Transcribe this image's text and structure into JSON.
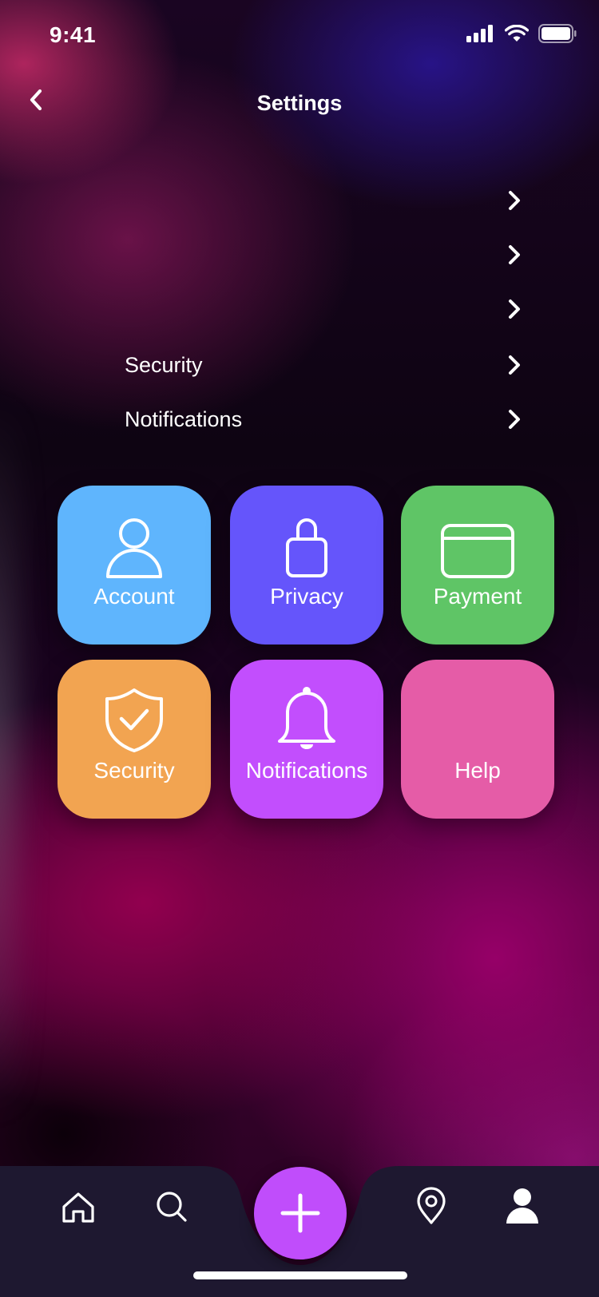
{
  "status_bar": {
    "time": "9:41"
  },
  "header": {
    "title": "Settings"
  },
  "list_items": [
    {
      "label": ""
    },
    {
      "label": ""
    },
    {
      "label": ""
    },
    {
      "label": "Security"
    },
    {
      "label": "Notifications"
    }
  ],
  "tiles": [
    {
      "label": "Account",
      "icon": "person-icon",
      "color": "#5fb5fd"
    },
    {
      "label": "Privacy",
      "icon": "lock-icon",
      "color": "#6555fb"
    },
    {
      "label": "Payment",
      "icon": "credit-card-icon",
      "color": "#5fc566"
    },
    {
      "label": "Security",
      "icon": "shield-check-icon",
      "color": "#f2a451"
    },
    {
      "label": "Notifications",
      "icon": "bell-icon",
      "color": "#c24efd"
    },
    {
      "label": "Help",
      "icon": "",
      "color": "#e55ca7"
    }
  ],
  "tab_bar": {
    "items": [
      "home-icon",
      "search-icon",
      "add-icon",
      "location-icon",
      "profile-icon"
    ],
    "fab_color": "#c04dfb",
    "bar_color": "#1e1830"
  }
}
